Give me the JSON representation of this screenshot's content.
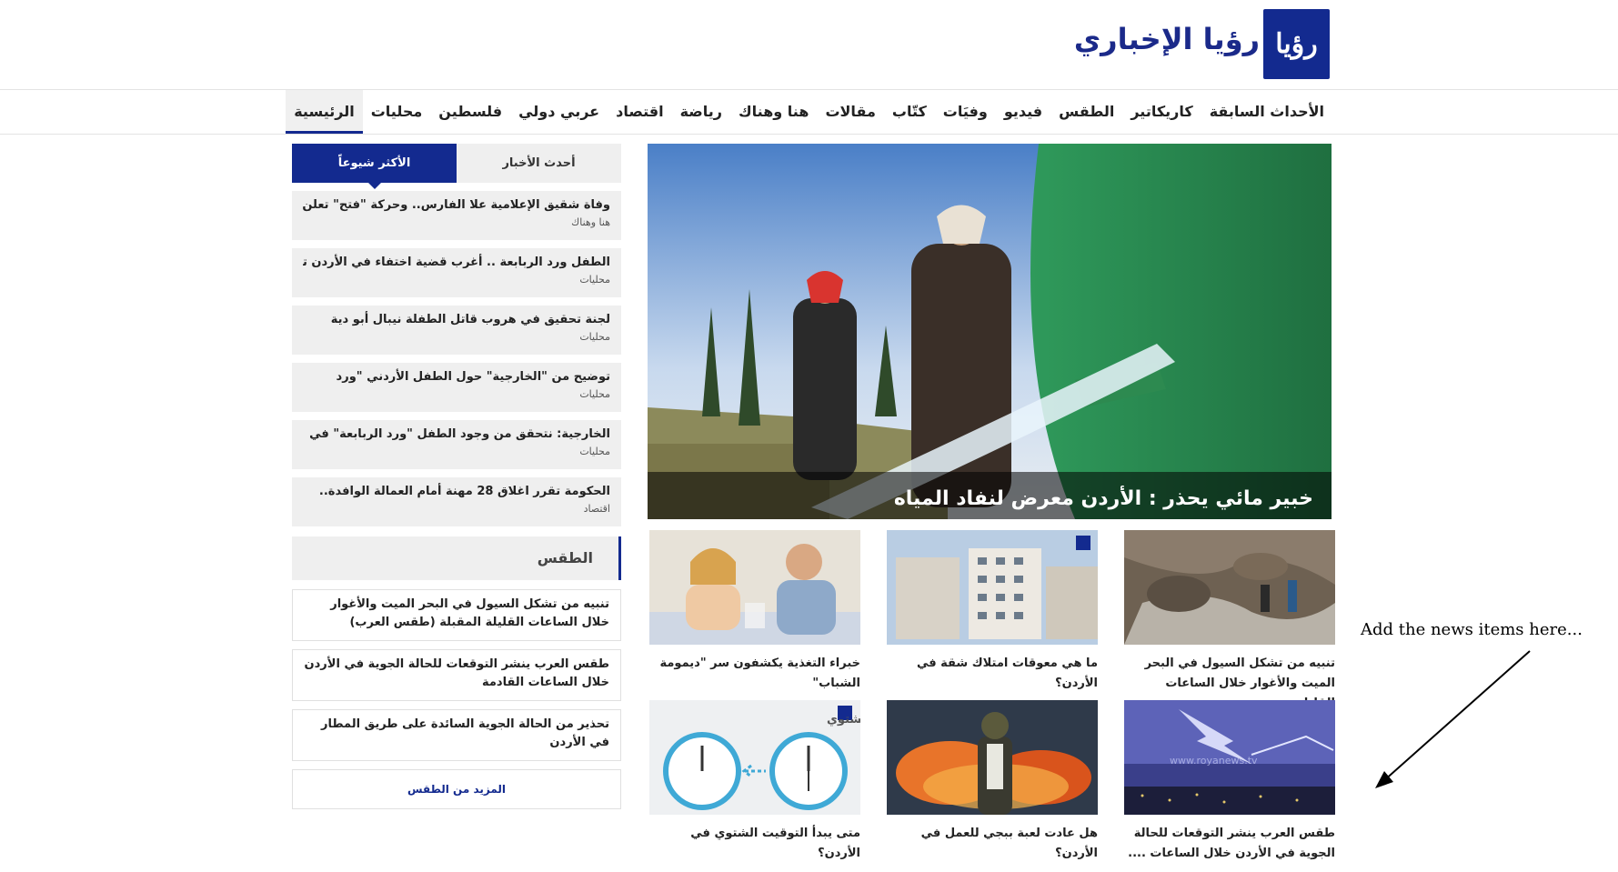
{
  "header": {
    "logo_mark": "رؤيا",
    "site_name": "رؤيا الإخباري"
  },
  "nav": {
    "items": [
      {
        "label": "الرئيسية",
        "active": true
      },
      {
        "label": "محليات"
      },
      {
        "label": "فلسطين"
      },
      {
        "label": "عربي دولي"
      },
      {
        "label": "اقتصاد"
      },
      {
        "label": "رياضة"
      },
      {
        "label": "هنا وهناك"
      },
      {
        "label": "مقالات"
      },
      {
        "label": "كتّاب"
      },
      {
        "label": "وفيَات"
      },
      {
        "label": "فيديو"
      },
      {
        "label": "الطقس"
      },
      {
        "label": "كاريكاتير"
      },
      {
        "label": "الأحداث السابقة"
      }
    ]
  },
  "hero": {
    "title": "خبير مائي يحذر : الأردن معرض لنفاد المياه"
  },
  "grid": [
    {
      "title": "تنبيه من تشكل السيول في البحر الميت والأغوار خلال الساعات القليلة ...."
    },
    {
      "title": "ما هي معوقات امتلاك شقة في الأردن؟"
    },
    {
      "title": "خبراء التغذية يكشفون سر \"ديمومة الشباب\""
    },
    {
      "title": "طقس العرب ينشر التوقعات للحالة الجوية في الأردن خلال الساعات ...."
    },
    {
      "title": "هل عادت لعبة ببجي للعمل في الأردن؟"
    },
    {
      "title": "متى يبدأ التوقيت الشتوي في الأردن؟"
    }
  ],
  "grid_image_texts": {
    "watermark": "www.royanews.tv",
    "clock_caption": "التوقيت الشتوي"
  },
  "sidebar": {
    "tabs": {
      "most_popular": "الأكثر شيوعاً",
      "latest": "أحدث الأخبار"
    },
    "popular": [
      {
        "title": "وفاة شقيق الإعلامية علا الفارس.. وحركة \"فتح\" تعلن",
        "category": "هنا وهناك"
      },
      {
        "title": "الطفل ورد الربابعة .. أغرب قضية اختفاء في الأردن تعود",
        "category": "محليات"
      },
      {
        "title": "لجنة تحقيق في هروب قاتل الطفلة نيبال أبو دية",
        "category": "محليات"
      },
      {
        "title": "توضيح من \"الخارجية\" حول الطفل الأردني \"ورد",
        "category": "محليات"
      },
      {
        "title": "الخارجية: نتحقق من وجود الطفل \"ورد الربابعة\" في",
        "category": "محليات"
      },
      {
        "title": "الحكومة تقرر اغلاق 28 مهنة أمام العمالة الوافدة..",
        "category": "اقتصاد"
      }
    ],
    "weather_heading": "الطقس",
    "weather": [
      {
        "title": "تنبيه من تشكل السيول في البحر الميت والأغوار خلال الساعات القليلة المقبلة (طقس العرب)"
      },
      {
        "title": "طقس العرب ينشر التوقعات للحالة الجوية في الأردن خلال الساعات القادمة"
      },
      {
        "title": "تحذير من الحالة الجوية السائدة على طريق المطار في الأردن"
      }
    ],
    "more_weather": "المزيد من الطقس"
  },
  "annotation": {
    "text": "Add the news items here..."
  },
  "colors": {
    "brand": "#132a8f",
    "panel": "#efefef"
  }
}
